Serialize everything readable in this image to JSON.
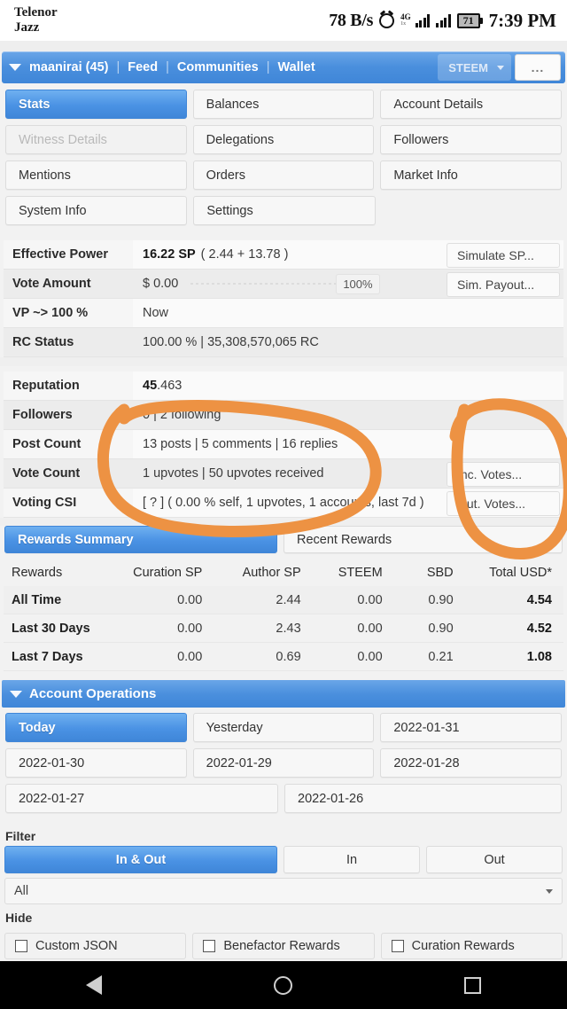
{
  "statusbar": {
    "carrier_line1": "Telenor",
    "carrier_line2": "Jazz",
    "net_speed": "78 B/s",
    "network_type": "4G",
    "network_sub": "1x",
    "battery": "71",
    "clock": "7:39 PM",
    "alarm_icon": "alarm-icon",
    "signal_icon": "signal-bars-icon"
  },
  "accountbar": {
    "caret_icon": "chevron-down-icon",
    "username": "maanirai (45)",
    "links": [
      "Feed",
      "Communities",
      "Wallet"
    ],
    "separator": "|",
    "token_selected": "STEEM",
    "more_label": "..."
  },
  "nav_tabs": [
    [
      {
        "label": "Stats",
        "state": "active"
      },
      {
        "label": "Balances",
        "state": "normal"
      },
      {
        "label": "Account Details",
        "state": "normal"
      }
    ],
    [
      {
        "label": "Witness Details",
        "state": "disabled"
      },
      {
        "label": "Delegations",
        "state": "normal"
      },
      {
        "label": "Followers",
        "state": "normal"
      }
    ],
    [
      {
        "label": "Mentions",
        "state": "normal"
      },
      {
        "label": "Orders",
        "state": "normal"
      },
      {
        "label": "Market Info",
        "state": "normal"
      }
    ],
    [
      {
        "label": "System Info",
        "state": "normal"
      },
      {
        "label": "Settings",
        "state": "normal"
      },
      {
        "label": "",
        "state": "ghost"
      }
    ]
  ],
  "stats_group_1": [
    {
      "label": "Effective Power",
      "value_bold": "16.22 SP",
      "value_rest": "( 2.44 + 13.78 )",
      "side_button": "Simulate SP...",
      "shaded": false
    },
    {
      "label": "Vote Amount",
      "value_bold": "",
      "value_rest": "$ 0.00",
      "progress_pct": "100%",
      "side_button": "Sim. Payout...",
      "shaded": true
    },
    {
      "label": "VP ~> 100 %",
      "value_bold": "",
      "value_rest": "Now",
      "side_button": "",
      "shaded": false
    },
    {
      "label": "RC Status",
      "value_bold": "",
      "value_rest": "100.00 %  |  35,308,570,065 RC",
      "side_button": "",
      "shaded": true
    }
  ],
  "stats_group_2": [
    {
      "label": "Reputation",
      "value_bold": "45",
      "value_rest": ".463",
      "side_button": "",
      "shaded": false
    },
    {
      "label": "Followers",
      "value_bold": "",
      "value_rest": "0  |  2 following",
      "side_button": "",
      "shaded": true
    },
    {
      "label": "Post Count",
      "value_bold": "",
      "value_rest": "13 posts  |  5 comments  |  16 replies",
      "side_button": "",
      "shaded": false
    },
    {
      "label": "Vote Count",
      "value_bold": "",
      "value_rest": "1 upvotes  |  50 upvotes received",
      "side_button": "Inc. Votes...",
      "shaded": true
    },
    {
      "label": "Voting CSI",
      "value_bold": "",
      "value_rest": "[ ? ] ( 0.00 % self, 1 upvotes, 1 accounts, last 7d )",
      "side_button": "Out. Votes...",
      "shaded": false
    }
  ],
  "rewards": {
    "tabs": [
      {
        "label": "Rewards Summary",
        "state": "active"
      },
      {
        "label": "Recent Rewards",
        "state": "normal"
      }
    ],
    "columns": [
      "Rewards",
      "Curation SP",
      "Author SP",
      "STEEM",
      "SBD",
      "Total USD*"
    ],
    "rows": [
      {
        "period": "All Time",
        "curation_sp": "0.00",
        "author_sp": "2.44",
        "steem": "0.00",
        "sbd": "0.90",
        "total_usd": "4.54"
      },
      {
        "period": "Last 30 Days",
        "curation_sp": "0.00",
        "author_sp": "2.43",
        "steem": "0.00",
        "sbd": "0.90",
        "total_usd": "4.52"
      },
      {
        "period": "Last 7 Days",
        "curation_sp": "0.00",
        "author_sp": "0.69",
        "steem": "0.00",
        "sbd": "0.21",
        "total_usd": "1.08"
      }
    ]
  },
  "account_operations": {
    "header": "Account Operations",
    "caret_icon": "chevron-down-icon",
    "date_tabs": [
      [
        {
          "label": "Today",
          "state": "active"
        },
        {
          "label": "Yesterday",
          "state": "normal"
        },
        {
          "label": "2022-01-31",
          "state": "normal"
        }
      ],
      [
        {
          "label": "2022-01-30",
          "state": "normal"
        },
        {
          "label": "2022-01-29",
          "state": "normal"
        },
        {
          "label": "2022-01-28",
          "state": "normal"
        }
      ]
    ],
    "date_tabs_last": [
      {
        "label": "2022-01-27",
        "state": "normal"
      },
      {
        "label": "2022-01-26",
        "state": "normal"
      }
    ],
    "filter_label": "Filter",
    "direction_tabs": [
      {
        "label": "In & Out",
        "state": "active"
      },
      {
        "label": "In",
        "state": "normal"
      },
      {
        "label": "Out",
        "state": "normal"
      }
    ],
    "type_select_value": "All",
    "hide_label": "Hide",
    "hide_options": [
      {
        "label": "Custom JSON",
        "checked": false
      },
      {
        "label": "Benefactor Rewards",
        "checked": false
      },
      {
        "label": "Curation Rewards",
        "checked": false
      }
    ]
  },
  "annotation": {
    "color": "#ed9243",
    "shapes": [
      "oval-around-stats-rows",
      "oval-around-votes-buttons"
    ]
  },
  "navbar": {
    "back_icon": "back-triangle-icon",
    "home_icon": "home-circle-icon",
    "recents_icon": "recents-square-icon"
  }
}
